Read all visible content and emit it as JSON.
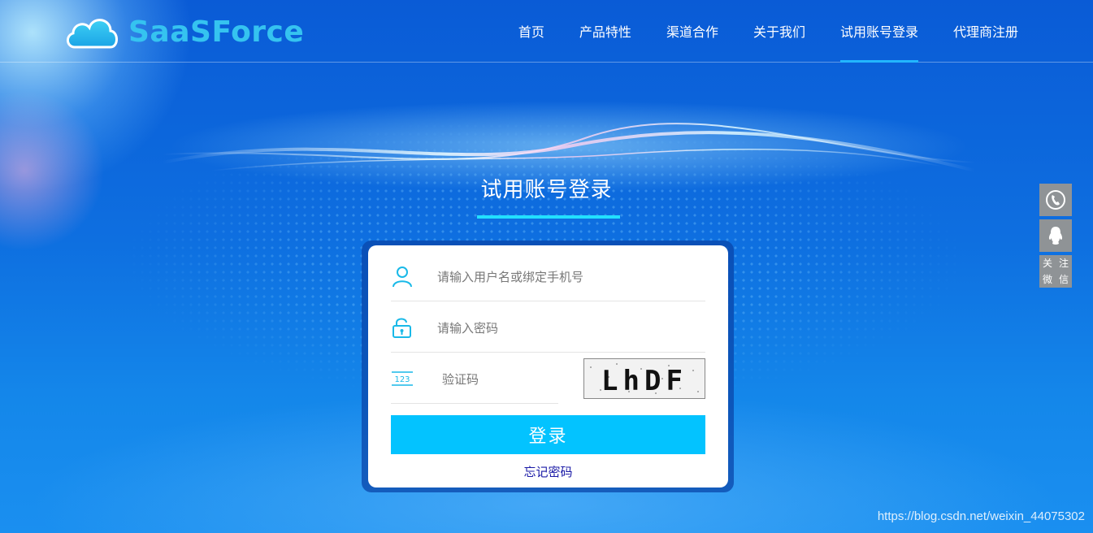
{
  "header": {
    "brand": "SaaSForce",
    "nav": [
      {
        "label": "首页"
      },
      {
        "label": "产品特性"
      },
      {
        "label": "渠道合作"
      },
      {
        "label": "关于我们"
      },
      {
        "label": "试用账号登录",
        "active": true
      },
      {
        "label": "代理商注册"
      }
    ]
  },
  "login": {
    "title": "试用账号登录",
    "username_placeholder": "请输入用户名或绑定手机号",
    "password_placeholder": "请输入密码",
    "code_placeholder": "验证码",
    "code_icon_text": "123",
    "captcha_text": "LhDF",
    "submit_label": "登录",
    "forgot_label": "忘记密码"
  },
  "side": {
    "wechat_chars": [
      "关",
      "注",
      "微",
      "信"
    ]
  },
  "watermark": "https://blog.csdn.net/weixin_44075302",
  "colors": {
    "accent": "#03c3ff",
    "nav_active_underline": "#22b6ff",
    "title_underline": "#22e0ff",
    "brand": "#35c3f0",
    "forgot_link": "#1a1aa6"
  }
}
